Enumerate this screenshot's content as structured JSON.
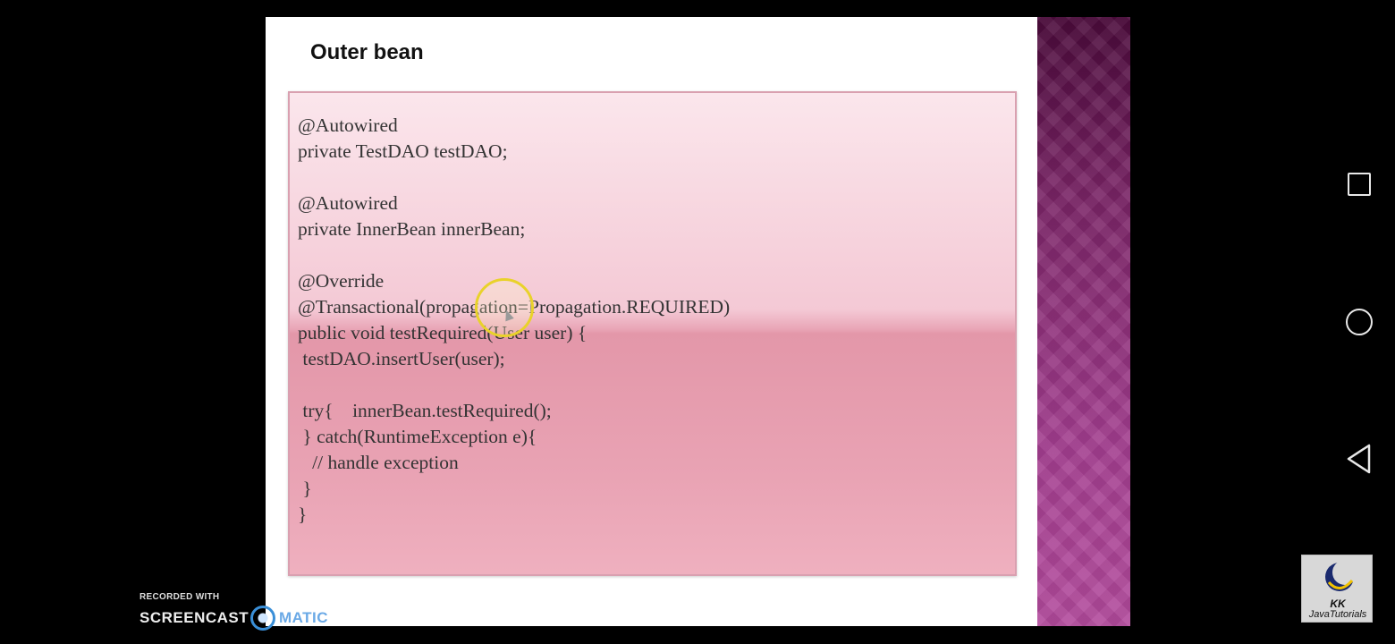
{
  "slide": {
    "title": "Outer bean",
    "code_lines": [
      "@Autowired",
      "private TestDAO testDAO;",
      "",
      "@Autowired",
      "private InnerBean innerBean;",
      "",
      "@Override",
      "@Transactional(propagation=Propagation.REQUIRED)",
      "public void testRequired(User user) {",
      " testDAO.insertUser(user);",
      "",
      " try{    innerBean.testRequired();",
      " } catch(RuntimeException e){",
      "   // handle exception",
      " }",
      "}"
    ]
  },
  "watermark": {
    "recorded_with": "RECORDED WITH",
    "brand_left": "SCREENCAST",
    "brand_right": "MATIC"
  },
  "logo": {
    "line1": "KK",
    "line2": "JavaTutorials"
  },
  "nav": {
    "icons": [
      "recent-apps-icon",
      "home-icon",
      "back-icon"
    ]
  },
  "colors": {
    "side_panel": "#8a2d78",
    "code_box": "#f0c0cc",
    "cursor_ring": "#e9d22a"
  }
}
